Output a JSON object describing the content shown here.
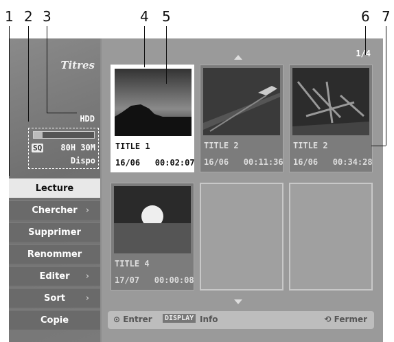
{
  "callouts": [
    "1",
    "2",
    "3",
    "4",
    "5",
    "6",
    "7"
  ],
  "panel": {
    "title": "Titres",
    "drive": "HDD",
    "usage_fraction": 0.15,
    "quality_badge": "SQ",
    "remaining": "80H 30M",
    "status": "Dispo"
  },
  "menu": [
    {
      "label": "Lecture",
      "selected": true,
      "submenu": false
    },
    {
      "label": "Chercher",
      "selected": false,
      "submenu": true
    },
    {
      "label": "Supprimer",
      "selected": false,
      "submenu": false
    },
    {
      "label": "Renommer",
      "selected": false,
      "submenu": false
    },
    {
      "label": "Editer",
      "selected": false,
      "submenu": true
    },
    {
      "label": "Sort",
      "selected": false,
      "submenu": true
    },
    {
      "label": "Copie",
      "selected": false,
      "submenu": false
    }
  ],
  "page_indicator": "1/4",
  "titles": [
    {
      "name": "TITLE 1",
      "date_time": "16/06   00:02:07",
      "image": "island-sunset"
    },
    {
      "name": "TITLE 2",
      "date_time": "16/06   00:11:36",
      "image": "boat-wake"
    },
    {
      "name": "TITLE 2",
      "date_time": "16/06   00:34:28",
      "image": "driftwood"
    },
    {
      "name": "TITLE 4",
      "date_time": "17/07   00:00:08",
      "image": "sun-over-sea"
    }
  ],
  "footer": {
    "enter": "Entrer",
    "display_key": "DISPLAY",
    "info": "Info",
    "close": "Fermer"
  }
}
